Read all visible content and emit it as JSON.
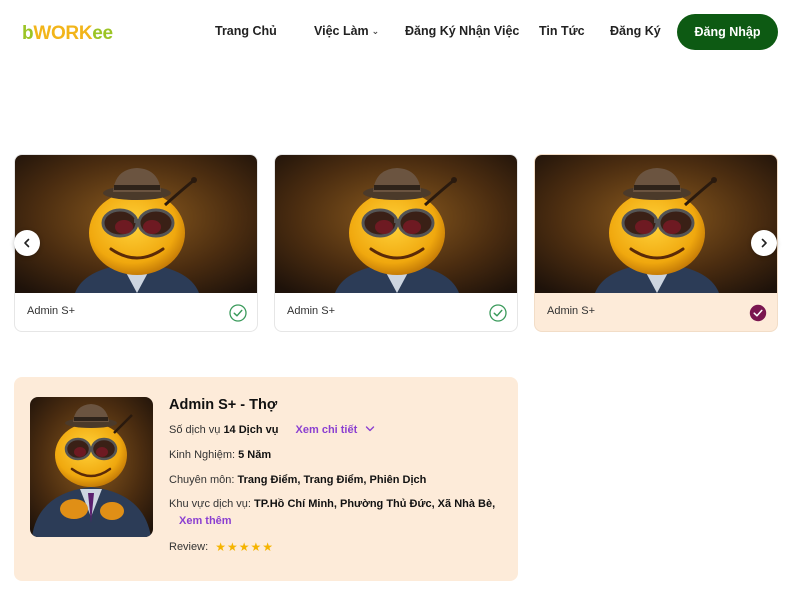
{
  "logo": {
    "part1": "b",
    "part2": "WORK",
    "part3": "ee"
  },
  "nav": {
    "home": "Trang Chủ",
    "jobs": "Việc Làm",
    "register_job": "Đăng Ký Nhận Việc",
    "news": "Tin Tức",
    "signup": "Đăng Ký",
    "login": "Đăng Nhập"
  },
  "carousel": {
    "cards": [
      {
        "name": "Admin S+",
        "selected": false
      },
      {
        "name": "Admin S+",
        "selected": false
      },
      {
        "name": "Admin S+",
        "selected": true
      }
    ]
  },
  "detail": {
    "title": "Admin S+ - Thợ",
    "services_label": "Số dịch vụ",
    "services_value": "14 Dịch vụ",
    "view_detail": "Xem chi tiết",
    "experience_label": "Kinh Nghiệm:",
    "experience_value": "5 Năm",
    "specialty_label": "Chuyên môn:",
    "specialty_value": "Trang Điểm, Trang Điểm, Phiên Dịch",
    "area_label": "Khu vực dịch vụ:",
    "area_value": "TP.Hồ Chí Minh, Phường Thủ Đức, Xã Nhà Bè,",
    "see_more": "Xem thêm",
    "review_label": "Review:",
    "rating": 5
  },
  "colors": {
    "brand_green": "#0d5a13",
    "selected_bg": "#fdebd9",
    "link_purple": "#8b3fd1",
    "check_green": "#3a9a5b",
    "check_selected": "#7a1650",
    "star": "#f5b400"
  }
}
